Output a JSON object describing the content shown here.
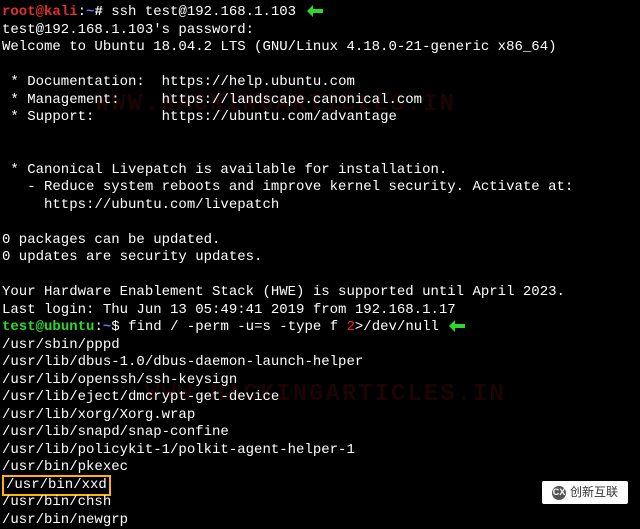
{
  "kali": {
    "user": "root",
    "at": "@",
    "host": "kali",
    "sep": ":",
    "path": "~",
    "prompt": "#",
    "command": "ssh test@192.168.1.103"
  },
  "login": {
    "passwordPrompt": "test@192.168.1.103's password:",
    "welcome": "Welcome to Ubuntu 18.04.2 LTS (GNU/Linux 4.18.0-21-generic x86_64)",
    "docLabel": " * Documentation:  ",
    "docUrl": "https://help.ubuntu.com",
    "mgmtLabel": " * Management:     ",
    "mgmtUrl": "https://landscape.canonical.com",
    "supLabel": " * Support:        ",
    "supUrl": "https://ubuntu.com/advantage",
    "livepatch1": " * Canonical Livepatch is available for installation.",
    "livepatch2": "   - Reduce system reboots and improve kernel security. Activate at:",
    "livepatch3": "     https://ubuntu.com/livepatch",
    "pkg1": "0 packages can be updated.",
    "pkg2": "0 updates are security updates.",
    "hwe": "Your Hardware Enablement Stack (HWE) is supported until April 2023.",
    "lastLogin": "Last login: Thu Jun 13 05:49:41 2019 from 192.168.1.17"
  },
  "ubuntu": {
    "user": "test",
    "at": "@",
    "host": "ubuntu",
    "sep": ":",
    "path": "~",
    "prompt": "$",
    "cmdPart1": "find / -perm -u=s -type f ",
    "cmdPart2": "2",
    "cmdPart3": ">/dev/null"
  },
  "results": [
    "/usr/sbin/pppd",
    "/usr/lib/dbus-1.0/dbus-daemon-launch-helper",
    "/usr/lib/openssh/ssh-keysign",
    "/usr/lib/eject/dmcrypt-get-device",
    "/usr/lib/xorg/Xorg.wrap",
    "/usr/lib/snapd/snap-confine",
    "/usr/lib/policykit-1/polkit-agent-helper-1",
    "/usr/bin/pkexec"
  ],
  "highlighted": "/usr/bin/xxd",
  "results2": [
    "/usr/bin/chsh",
    "/usr/bin/newgrp"
  ],
  "watermark": "WWW.HACKINGARTICLES.IN",
  "badge": {
    "icon": "CX",
    "text": "创新互联"
  }
}
